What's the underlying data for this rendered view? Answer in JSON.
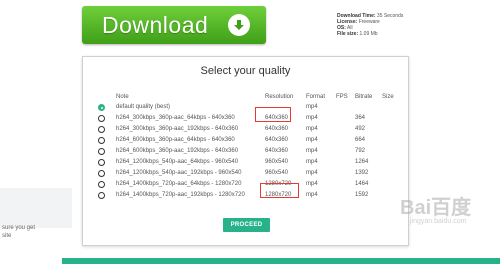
{
  "download": {
    "label": "Download",
    "info": {
      "time_label": "Download Time:",
      "time_value": "35 Seconds",
      "license_label": "License:",
      "license_value": "Freeware",
      "os_label": "OS:",
      "os_value": "All",
      "size_label": "File size:",
      "size_value": "1.09 Mb"
    }
  },
  "modal": {
    "title": "Select your quality",
    "headers": {
      "note": "Note",
      "resolution": "Resolution",
      "format": "Format",
      "fps": "FPS",
      "bitrate": "Bitrate",
      "size": "Size"
    },
    "rows": [
      {
        "note": "default quality (best)",
        "resolution": "",
        "format": "mp4",
        "fps": "",
        "bitrate": "",
        "size": "",
        "selected": true
      },
      {
        "note": "h264_300kbps_360p-aac_64kbps - 640x360",
        "resolution": "640x360",
        "format": "mp4",
        "fps": "",
        "bitrate": "364",
        "size": "",
        "selected": false
      },
      {
        "note": "h264_300kbps_360p-aac_192kbps - 640x360",
        "resolution": "640x360",
        "format": "mp4",
        "fps": "",
        "bitrate": "492",
        "size": "",
        "selected": false
      },
      {
        "note": "h264_600kbps_360p-aac_64kbps - 640x360",
        "resolution": "640x360",
        "format": "mp4",
        "fps": "",
        "bitrate": "664",
        "size": "",
        "selected": false
      },
      {
        "note": "h264_600kbps_360p-aac_192kbps - 640x360",
        "resolution": "640x360",
        "format": "mp4",
        "fps": "",
        "bitrate": "792",
        "size": "",
        "selected": false
      },
      {
        "note": "h264_1200kbps_540p-aac_64kbps - 960x540",
        "resolution": "960x540",
        "format": "mp4",
        "fps": "",
        "bitrate": "1264",
        "size": "",
        "selected": false
      },
      {
        "note": "h264_1200kbps_540p-aac_192kbps - 960x540",
        "resolution": "960x540",
        "format": "mp4",
        "fps": "",
        "bitrate": "1392",
        "size": "",
        "selected": false
      },
      {
        "note": "h264_1400kbps_720p-aac_64kbps - 1280x720",
        "resolution": "1280x720",
        "format": "mp4",
        "fps": "",
        "bitrate": "1464",
        "size": "",
        "selected": false
      },
      {
        "note": "h264_1400kbps_720p-aac_192kbps - 1280x720",
        "resolution": "1280x720",
        "format": "mp4",
        "fps": "",
        "bitrate": "1592",
        "size": "",
        "selected": false
      }
    ],
    "proceed_label": "PROCEED"
  },
  "left_panel": {
    "line1": "sure you get",
    "line2": "site"
  },
  "watermark": {
    "brand": "Bai百度",
    "domain": "jingyan.baidu.com"
  },
  "colors": {
    "download_green": "#4caf20",
    "accent_teal": "#27b28c",
    "highlight_red": "#e53935"
  }
}
